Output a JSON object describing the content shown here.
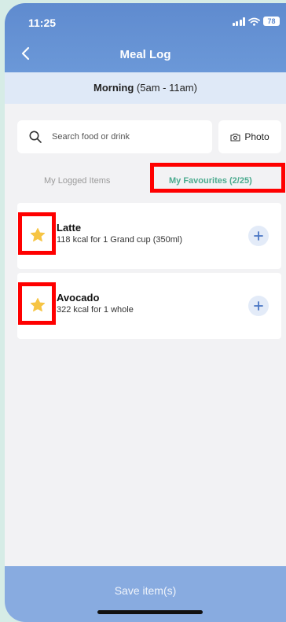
{
  "status_bar": {
    "time": "11:25",
    "battery": "78"
  },
  "header": {
    "title": "Meal Log",
    "back_icon": "chevron-left-icon"
  },
  "meal_period": {
    "name": "Morning",
    "range": "(5am - 11am)"
  },
  "search": {
    "placeholder": "Search food or drink",
    "value": ""
  },
  "photo_button": {
    "label": "Photo",
    "icon": "camera-icon"
  },
  "tabs": [
    {
      "label": "My Logged Items",
      "active": false
    },
    {
      "label": "My Favourites (2/25)",
      "active": true
    }
  ],
  "items": [
    {
      "name": "Latte",
      "detail": "118 kcal for 1 Grand cup (350ml)",
      "favourite": true
    },
    {
      "name": "Avocado",
      "detail": "322 kcal for 1 whole",
      "favourite": true
    }
  ],
  "save_button": {
    "label": "Save item(s)"
  },
  "colors": {
    "header": "#6b98d8",
    "active_tab": "#4cab8f",
    "star": "#f6c443",
    "highlight": "#ff0000",
    "save_bar": "#88abe0"
  }
}
